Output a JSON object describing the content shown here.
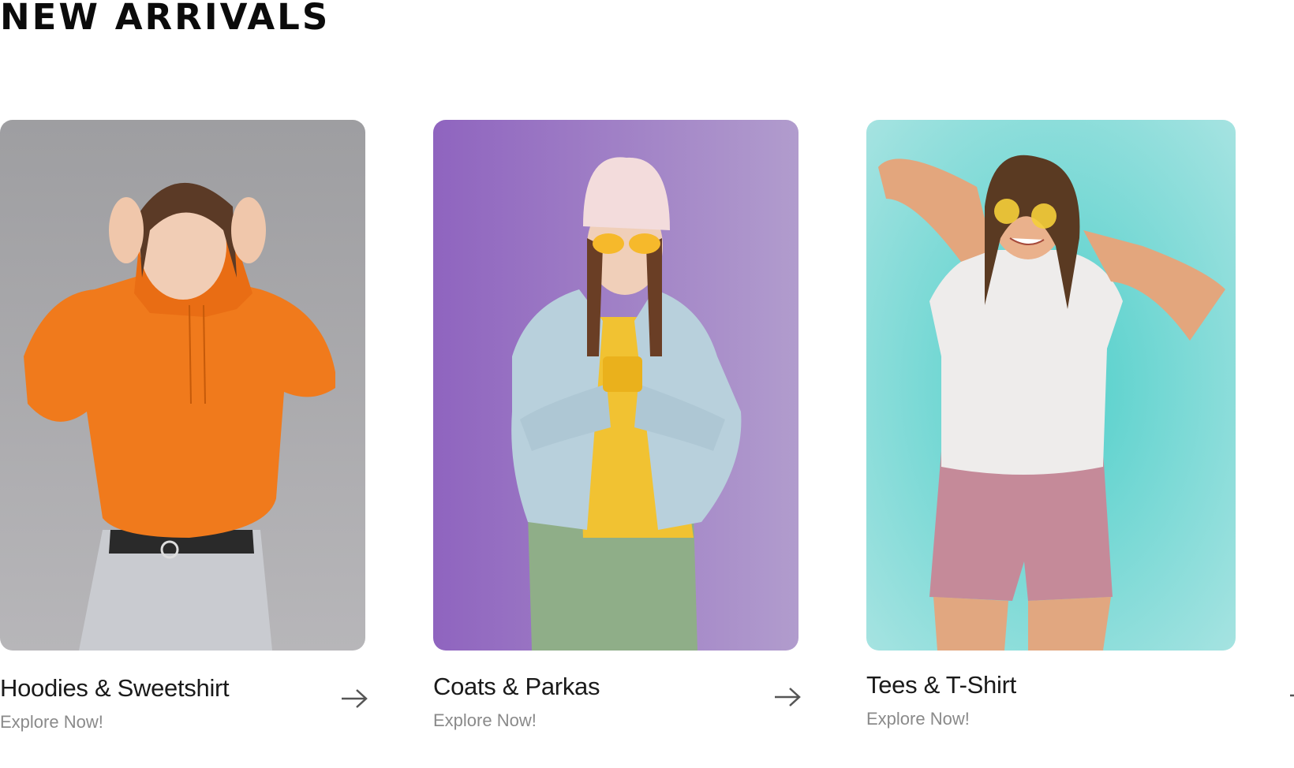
{
  "section": {
    "title": "NEW ARRIVALS"
  },
  "cards": [
    {
      "title": "Hoodies & Sweetshirt",
      "cta": "Explore Now!",
      "arrow_icon": "arrow-right-icon",
      "background": "#a3a3a6",
      "image_subject": "model-orange-hoodie"
    },
    {
      "title": "Coats & Parkas",
      "cta": "Explore Now!",
      "arrow_icon": "arrow-right-icon",
      "background": "#9d7cc8",
      "image_subject": "model-denim-jacket"
    },
    {
      "title": "Tees & T-Shirt",
      "cta": "Explore Now!",
      "arrow_icon": "arrow-right-icon",
      "background": "#7fd8d2",
      "image_subject": "model-white-tee"
    }
  ],
  "colors": {
    "title_text": "#1a1a1a",
    "cta_text": "#8a8a8a",
    "arrow": "#555555"
  }
}
